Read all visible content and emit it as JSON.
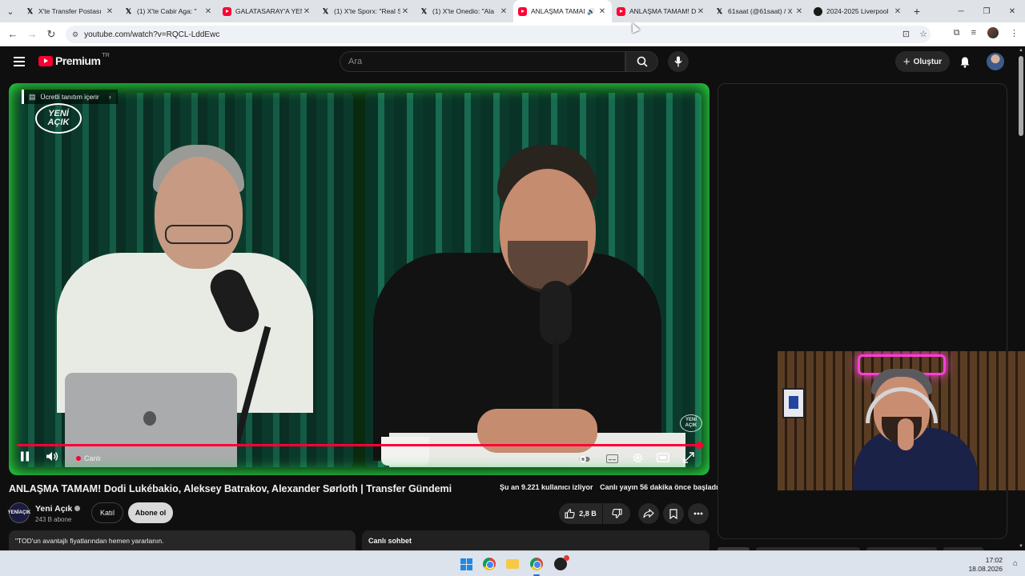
{
  "browser": {
    "tabs": [
      {
        "icon": "x-icon",
        "title": "X'te Transfer Postası"
      },
      {
        "icon": "x-icon",
        "title": "(1) X'te Cabir Aga: \""
      },
      {
        "icon": "youtube-icon",
        "title": "GALATASARAY'A YENİ"
      },
      {
        "icon": "x-icon",
        "title": "(1) X'te Sporx: \"Real S"
      },
      {
        "icon": "x-icon",
        "title": "(1) X'te Onedio: \"Ala"
      },
      {
        "icon": "youtube-icon",
        "title": "ANLAŞMA TAMAM",
        "active": true,
        "audio": true
      },
      {
        "icon": "youtube-icon",
        "title": "ANLAŞMA TAMAM! D"
      },
      {
        "icon": "x-icon",
        "title": "61saat (@61saat) / X"
      },
      {
        "icon": "spotify-icon",
        "title": "2024-2025 Liverpool"
      }
    ],
    "url": "youtube.com/watch?v=RQCL-LddEwc"
  },
  "youtube": {
    "logo_text": "Premium",
    "country_code": "TR",
    "search_placeholder": "Ara",
    "create_label": "Oluştur"
  },
  "player": {
    "sponsor_label": "Ücretli tanıtım içerir",
    "brand_line1": "YENİ",
    "brand_line2": "AÇIK",
    "live_label": "Canlı",
    "progress": 0.995
  },
  "video": {
    "title": "ANLAŞMA TAMAM! Dodi Lukébakio, Aleksey Batrakov, Alexander Sørloth | Transfer Gündemi",
    "viewers": "Şu an 9.221 kullanıcı izliyor",
    "started": "Canlı yayın 56 dakika önce başladı",
    "channel_name": "Yeni Açık",
    "subscribers": "243 B abone",
    "join_label": "Katıl",
    "subscribe_label": "Abone ol",
    "likes": "2,8 B",
    "description_preview": "\"TOD'un avantajlı fiyatlarından hemen yararlanın.",
    "chat_title": "Canlı sohbet"
  },
  "taskbar": {
    "time": "17:02",
    "date": "18.08.2026"
  },
  "colors": {
    "yt_red": "#ff0033",
    "bg": "#0f0f0f",
    "green_glow": "#2ad84a",
    "neon_pink": "#ff3fd8"
  }
}
